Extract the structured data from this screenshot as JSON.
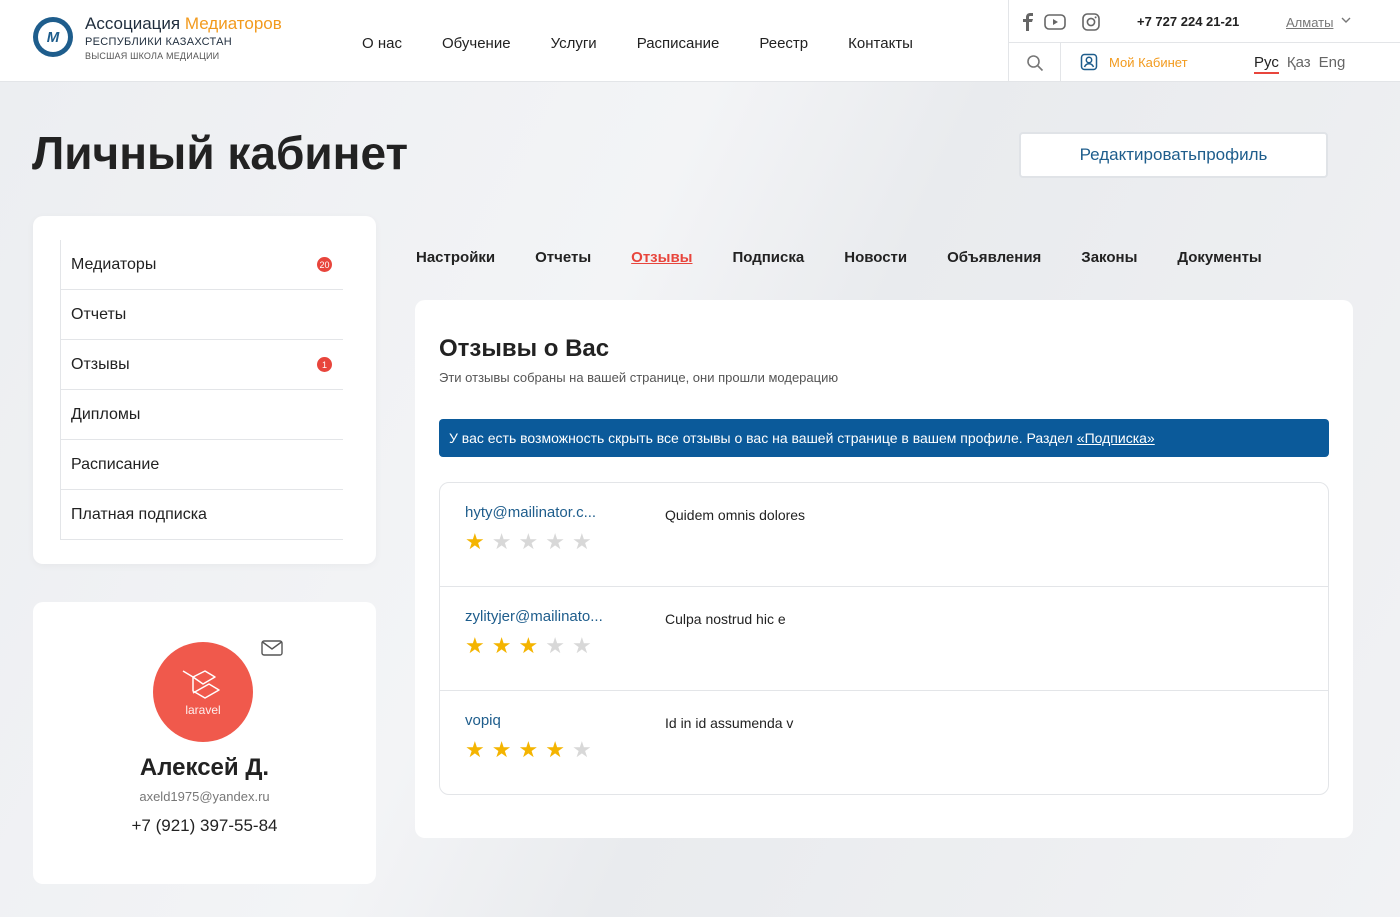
{
  "header": {
    "brand_main": "Ассоциация",
    "brand_accent": "Медиаторов",
    "brand_sub": "РЕСПУБЛИКИ КАЗАХСТАН",
    "brand_school": "ВЫСШАЯ ШКОЛА МЕДИАЦИИ",
    "nav": [
      "О нас",
      "Обучение",
      "Услуги",
      "Расписание",
      "Реестр",
      "Контакты"
    ],
    "phone": "+7 727 224 21-21",
    "city": "Алматы",
    "cabinet_label": "Мой Кабинет",
    "languages": [
      "Рус",
      "Қаз",
      "Eng"
    ],
    "active_language": "Рус"
  },
  "page": {
    "title": "Личный кабинет",
    "edit_button": "Редактироватьпрофиль"
  },
  "sidebar": {
    "items": [
      {
        "label": "Медиаторы",
        "badge": "20"
      },
      {
        "label": "Отчеты",
        "badge": null
      },
      {
        "label": "Отзывы",
        "badge": "1"
      },
      {
        "label": "Дипломы",
        "badge": null
      },
      {
        "label": "Расписание",
        "badge": null
      },
      {
        "label": "Платная подписка",
        "badge": null
      }
    ]
  },
  "profile": {
    "avatar_text": "laravel",
    "name": "Алексей Д.",
    "email": "axeld1975@yandex.ru",
    "phone": "+7 (921) 397-55-84"
  },
  "tabs": [
    "Настройки",
    "Отчеты",
    "Отзывы",
    "Подписка",
    "Новости",
    "Объявления",
    "Законы",
    "Документы"
  ],
  "active_tab": "Отзывы",
  "main": {
    "title": "Отзывы о Вас",
    "subtitle": "Эти отзывы собраны на вашей странице, они прошли модерацию",
    "notice_text": "У вас есть возможность скрыть все отзывы о вас на вашей странице в вашем профиле. Раздел",
    "notice_link": "«Подписка»"
  },
  "reviews": [
    {
      "author": "hyty@mailinator.c...",
      "rating": 1,
      "max": 5,
      "text": "Quidem omnis dolores"
    },
    {
      "author": "zylityjer@mailinato...",
      "rating": 3,
      "max": 5,
      "text": "Culpa nostrud hic e"
    },
    {
      "author": "vopiq",
      "rating": 4,
      "max": 5,
      "text": "Id in id assumenda v"
    }
  ],
  "colors": {
    "brand_blue": "#1e5d8c",
    "accent_orange": "#f29a1d",
    "badge_red": "#e8453c",
    "notice_blue": "#0b5a9a",
    "star_gold": "#f4b400"
  }
}
